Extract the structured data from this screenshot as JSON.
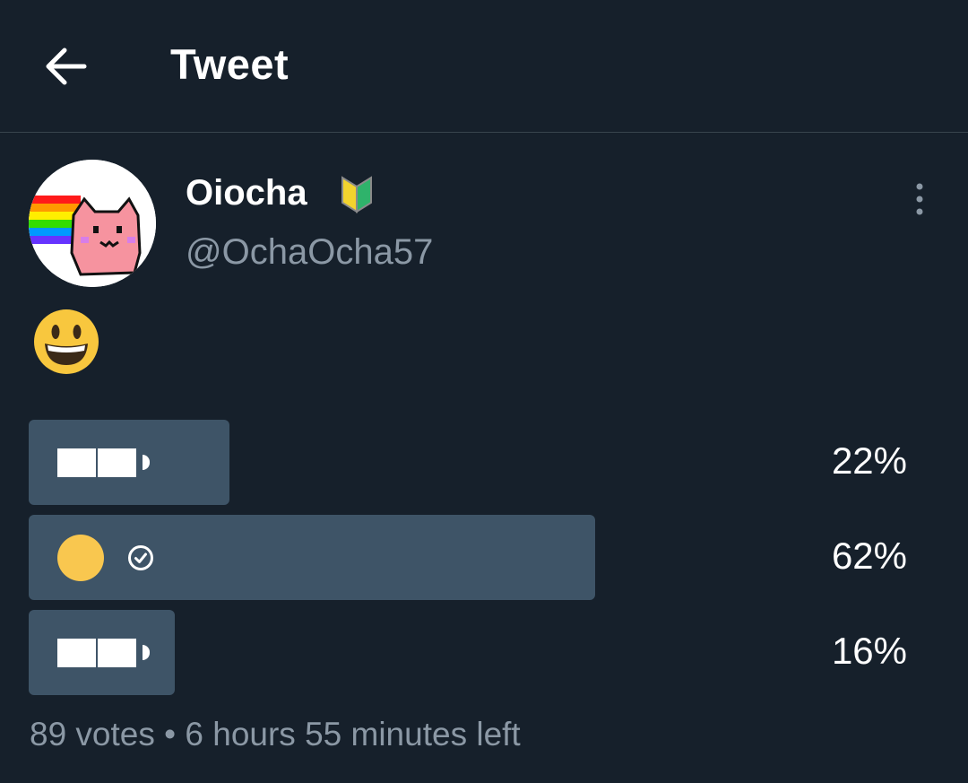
{
  "header": {
    "title": "Tweet",
    "back_icon": "arrow-left-icon"
  },
  "author": {
    "display_name": "Oiocha",
    "handle": "@OchaOcha57",
    "badge_icon": "beginner-mark-icon",
    "avatar": "nyan-cat-avatar"
  },
  "more_icon": "more-vertical-icon",
  "tweet": {
    "emoji": "😃",
    "emoji_icon": "grinning-face-icon"
  },
  "poll": {
    "options": [
      {
        "icon": "battery-icon",
        "percent_label": "22%",
        "fraction": 0.22,
        "selected": false
      },
      {
        "icon": "yellow-circle-icon",
        "percent_label": "62%",
        "fraction": 0.62,
        "selected": true
      },
      {
        "icon": "battery-icon",
        "percent_label": "16%",
        "fraction": 0.16,
        "selected": false
      }
    ],
    "footer": "89 votes • 6 hours 55 minutes left"
  },
  "colors": {
    "background": "#16202b",
    "bar": "#3e5467",
    "muted_text": "#8b98a5",
    "divider": "#38444d",
    "accent_yellow": "#f9c74f"
  }
}
